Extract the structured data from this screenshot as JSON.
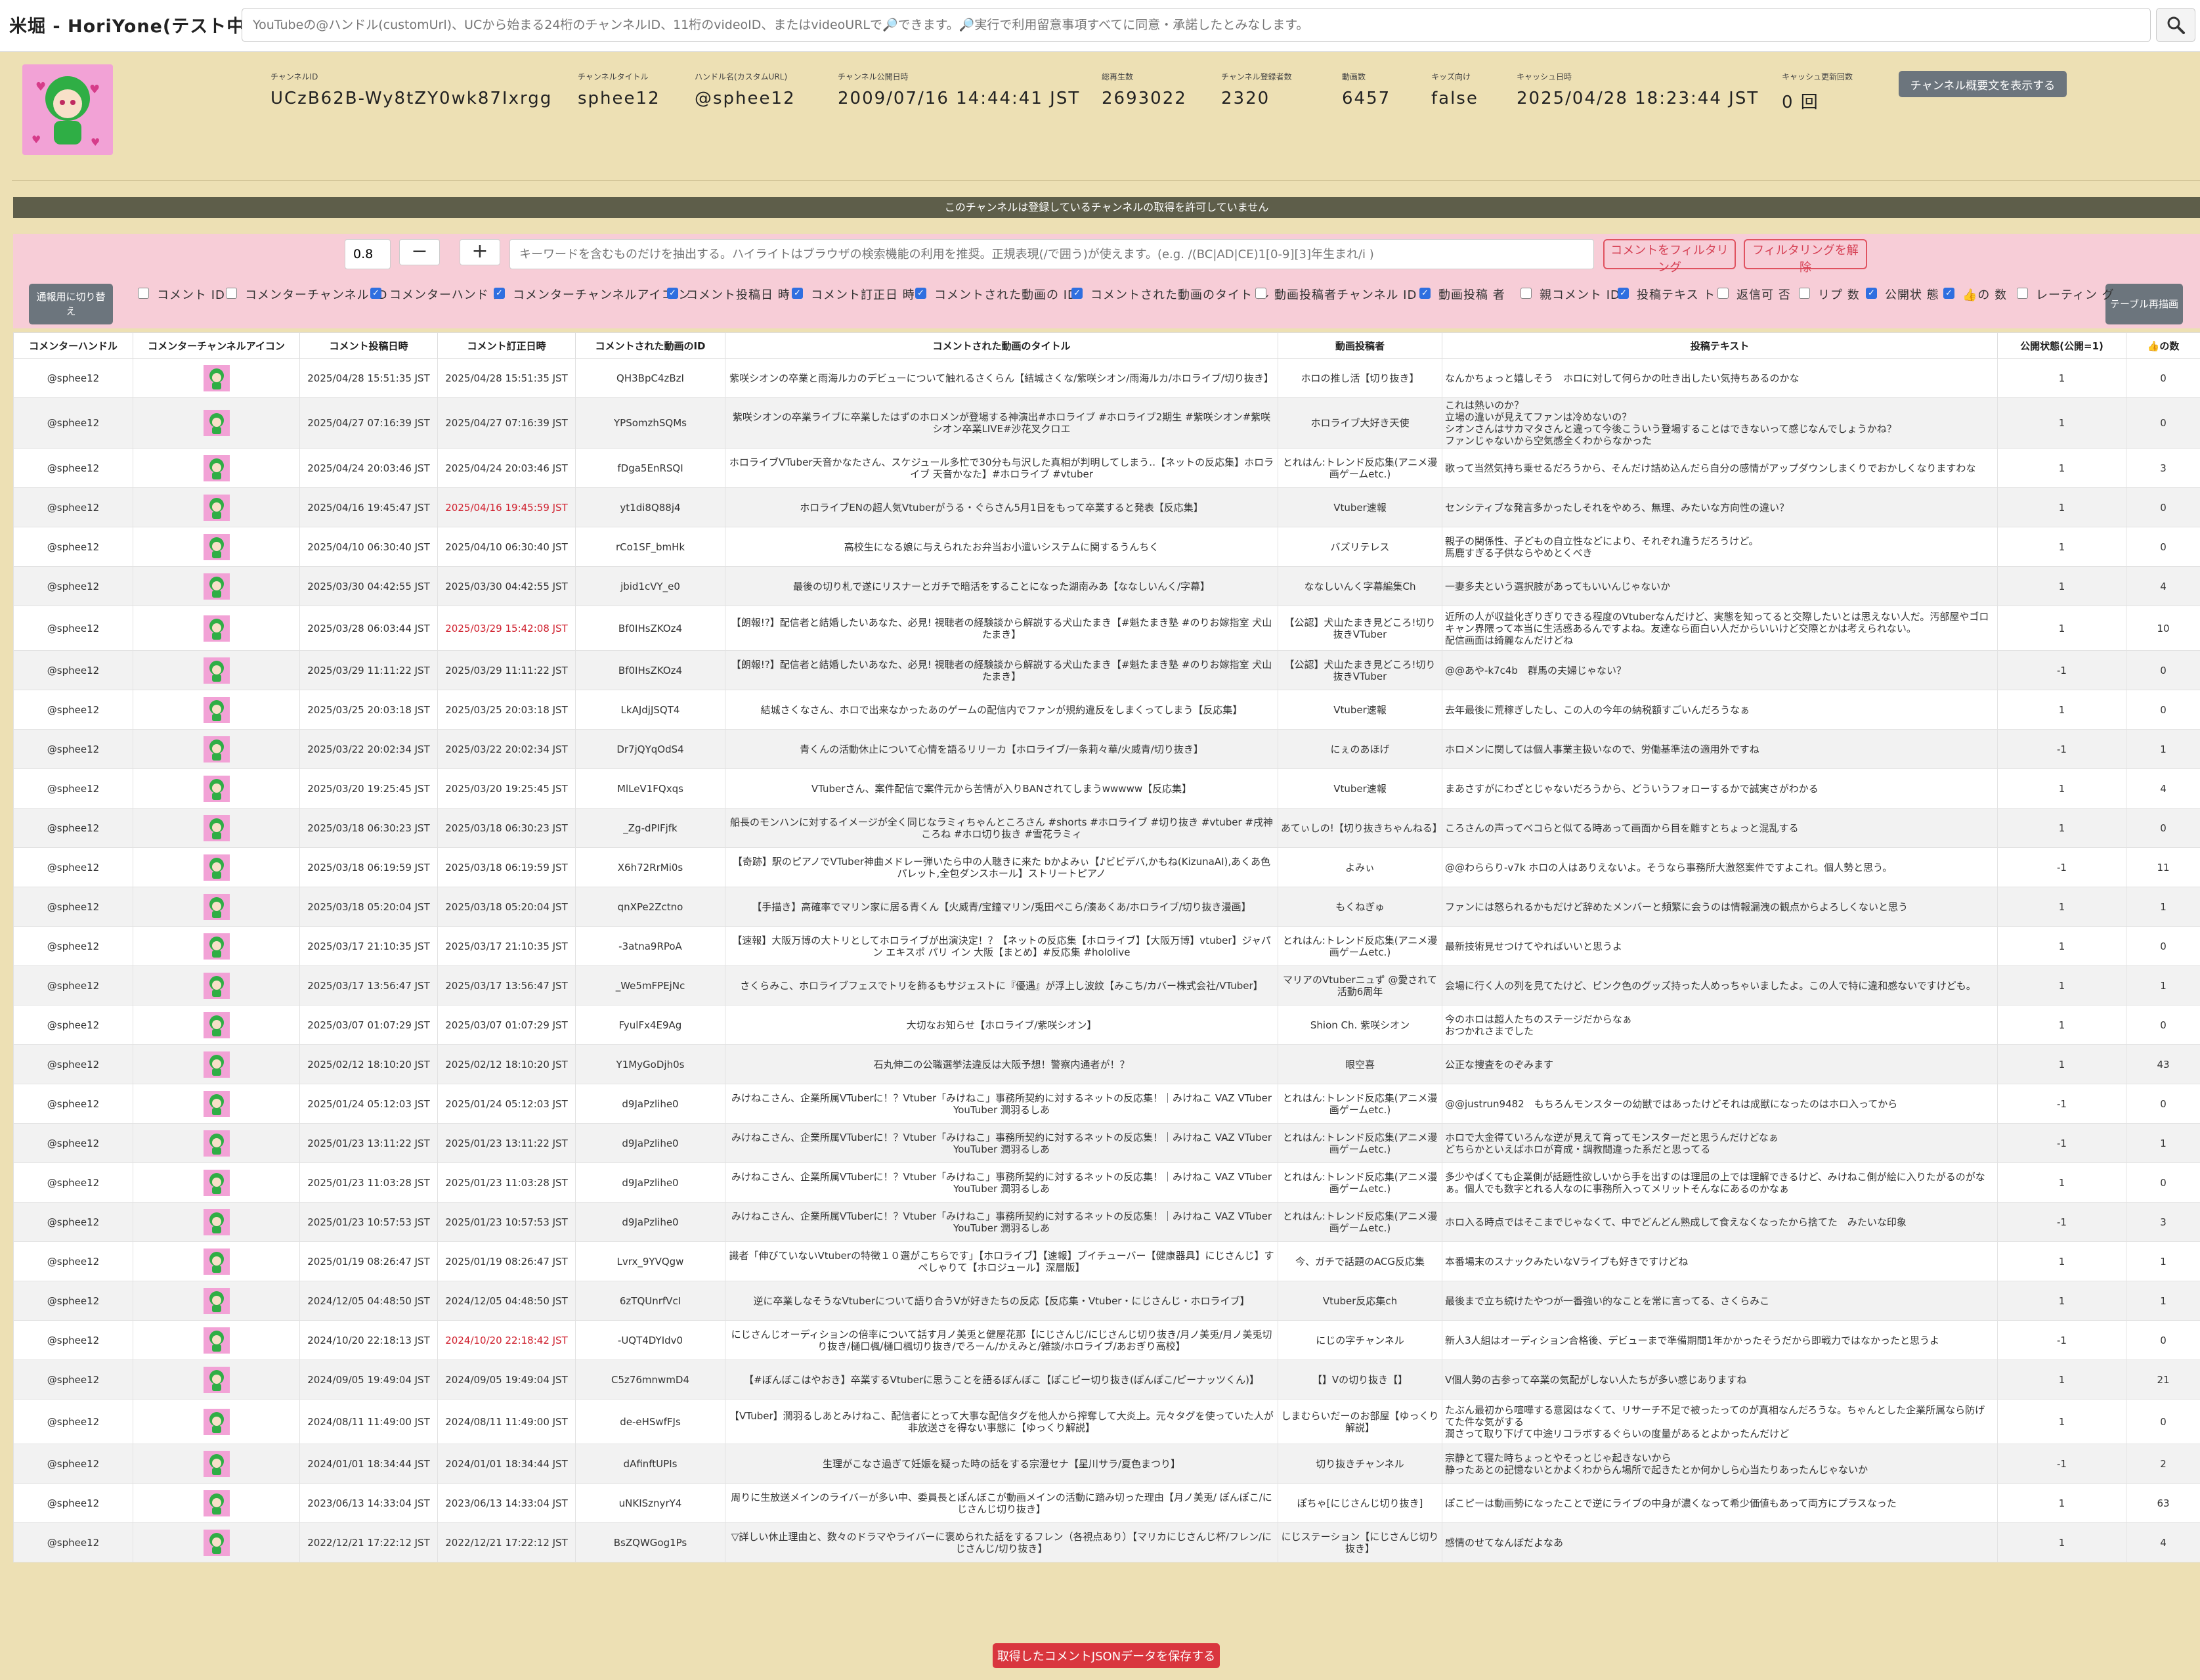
{
  "app": {
    "title": "米堀 - HoriYone(テスト中)"
  },
  "search": {
    "placeholder": "YouTubeの@ハンドル(customUrl)、UCから始まる24桁のチャンネルID、11桁のvideoID、またはvideoURLで🔎できます。🔎実行で利用留意事項すべてに同意・承諾したとみなします。"
  },
  "channel": {
    "fields": [
      {
        "label": "チャンネルID",
        "value": "UCzB62B-Wy8tZY0wk87Ixrgg"
      },
      {
        "label": "チャンネルタイトル",
        "value": "sphee12"
      },
      {
        "label": "ハンドル名(カスタムURL)",
        "value": "@sphee12"
      },
      {
        "label": "チャンネル公開日時",
        "value": "2009/07/16 14:44:41 JST"
      },
      {
        "label": "総再生数",
        "value": "2693022"
      },
      {
        "label": "チャンネル登録者数",
        "value": "2320"
      },
      {
        "label": "動画数",
        "value": "6457"
      },
      {
        "label": "キッズ向け",
        "value": "false"
      },
      {
        "label": "キャッシュ日時",
        "value": "2025/04/28 18:23:44 JST"
      },
      {
        "label": "キャッシュ更新回数",
        "value": "0 回"
      }
    ],
    "desc_button": "チャンネル概要文を表示する"
  },
  "notice": "このチャンネルは登録しているチャンネルの取得を許可していません",
  "filter": {
    "threshold": "0.8",
    "minus": "−",
    "plus": "+",
    "keyword_placeholder": "キーワードを含むものだけを抽出する。ハイライトはブラウザの検索機能の利用を推奨。正規表現(/で囲う)が使えます。(e.g. /(BC|AD|CE)1[0-9][3]年生まれ/i )",
    "apply_button": "コメントをフィルタリング",
    "clear_button": "フィルタリングを解除",
    "switch_button": "通報用に切り替え",
    "redraw_button": "テーブル再描画",
    "columns": [
      {
        "label": "コメント ID",
        "checked": false
      },
      {
        "label": "コメンターチャンネル ID",
        "checked": false
      },
      {
        "label": "コメンターハンド ル",
        "checked": true
      },
      {
        "label": "コメンターチャンネルアイコ ン",
        "checked": true
      },
      {
        "label": "コメント投稿日 時",
        "checked": true
      },
      {
        "label": "コメント訂正日 時",
        "checked": true
      },
      {
        "label": "コメントされた動画の ID",
        "checked": true
      },
      {
        "label": "コメントされた動画のタイト ル",
        "checked": true
      },
      {
        "label": "動画投稿者チャンネル ID",
        "checked": false
      },
      {
        "label": "動画投稿 者",
        "checked": true
      },
      {
        "label": "親コメント ID",
        "checked": false
      },
      {
        "label": "投稿テキス ト",
        "checked": true
      },
      {
        "label": "返信可 否",
        "checked": false
      },
      {
        "label": "リプ 数",
        "checked": false
      },
      {
        "label": "公開状 態",
        "checked": true
      },
      {
        "label": "👍の 数",
        "checked": true
      },
      {
        "label": "レーティン グ",
        "checked": false
      }
    ]
  },
  "table": {
    "headers": [
      "コメンターハンドル",
      "コメンターチャンネルアイコン",
      "コメント投稿日時",
      "コメント訂正日時",
      "コメントされた動画のID",
      "コメントされた動画のタイトル",
      "動画投稿者",
      "投稿テキスト",
      "公開状態(公開=1)",
      "👍の数"
    ],
    "rows": [
      {
        "handle": "@sphee12",
        "posted": "2025/04/28 15:51:35 JST",
        "edited": "2025/04/28 15:51:35 JST",
        "edited_red": false,
        "video_id": "QH3BpC4zBzI",
        "title": "紫咲シオンの卒業と雨海ルカのデビューについて触れるさくらん【結城さくな/紫咲シオン/雨海ルカ/ホロライブ/切り抜き】",
        "uploader": "ホロの推し活【切り抜き】",
        "text": "なんかちょっと嬉しそう　ホロに対して何らかの吐き出したい気持ちあるのかな",
        "status": "1",
        "likes": "0"
      },
      {
        "handle": "@sphee12",
        "posted": "2025/04/27 07:16:39 JST",
        "edited": "2025/04/27 07:16:39 JST",
        "edited_red": false,
        "video_id": "YPSomzhSQMs",
        "title": "紫咲シオンの卒業ライブに卒業したはずのホロメンが登場する神演出#ホロライブ #ホロライブ2期生 #紫咲シオン#紫咲シオン卒業LIVE#沙花叉クロエ",
        "uploader": "ホロライブ大好き天使",
        "text": "これは熱いのか？\n立場の違いが見えてファンは冷めないの？\nシオンさんはサカマタさんと違って今後こういう登場することはできないって感じなんでしょうかね？\nファンじゃないから空気感全くわからなかった",
        "status": "1",
        "likes": "0"
      },
      {
        "handle": "@sphee12",
        "posted": "2025/04/24 20:03:46 JST",
        "edited": "2025/04/24 20:03:46 JST",
        "edited_red": false,
        "video_id": "fDga5EnRSQI",
        "title": "ホロライブVTuber天音かなたさん、スケジュール多忙で30分も与沢した真相が判明してしまう‥【ネットの反応集】ホロライブ 天音かなた】#ホロライブ #vtuber",
        "uploader": "とれはん:トレンド反応集(アニメ漫画ゲームetc.)",
        "text": "歌って当然気持ち乗せるだろうから、そんだけ詰め込んだら自分の感情がアップダウンしまくりでおかしくなりますわな",
        "status": "1",
        "likes": "3"
      },
      {
        "handle": "@sphee12",
        "posted": "2025/04/16 19:45:47 JST",
        "edited": "2025/04/16 19:45:59 JST",
        "edited_red": true,
        "video_id": "yt1di8Q88j4",
        "title": "ホロライブENの超人気Vtuberがうる・ぐらさん5月1日をもって卒業すると発表【反応集】",
        "uploader": "Vtuber速報",
        "text": "センシティブな発言多かったしそれをやめろ、無理、みたいな方向性の違い？",
        "status": "1",
        "likes": "0"
      },
      {
        "handle": "@sphee12",
        "posted": "2025/04/10 06:30:40 JST",
        "edited": "2025/04/10 06:30:40 JST",
        "edited_red": false,
        "video_id": "rCo1SF_bmHk",
        "title": "高校生になる娘に与えられたお弁当お小遣いシステムに関するうんちく",
        "uploader": "バズリテレス",
        "text": "親子の関係性、子どもの自立性などにより、それぞれ違うだろうけど。\n馬鹿すぎる子供ならやめとくべき",
        "status": "1",
        "likes": "0"
      },
      {
        "handle": "@sphee12",
        "posted": "2025/03/30 04:42:55 JST",
        "edited": "2025/03/30 04:42:55 JST",
        "edited_red": false,
        "video_id": "jbid1cVY_e0",
        "title": "最後の切り札で遂にリスナーとガチで暗活をすることになった湖南みあ【ななしいんく/字幕】",
        "uploader": "ななしいんく字幕編集Ch",
        "text": "一妻多夫という選択肢があってもいいんじゃないか",
        "status": "1",
        "likes": "4"
      },
      {
        "handle": "@sphee12",
        "posted": "2025/03/28 06:03:44 JST",
        "edited": "2025/03/29 15:42:08 JST",
        "edited_red": true,
        "video_id": "Bf0IHsZKOz4",
        "title": "【朗報!?】配信者と結婚したいあなた、必見! 視聴者の経験談から解説する犬山たまき【#魁たまき塾 #のりお嫁指室 犬山たまき】",
        "uploader": "【公認】犬山たまき見どころ!切り抜きVTuber",
        "text": "近所の人が収益化ぎりぎりできる程度のVtuberなんだけど、実態を知ってると交際したいとは思えない人だ。汚部屋やゴロキャン界隈って本当に生活感あるんですよね。友達なら面白い人だからいいけど交際とかは考えられない。\n配信画面は綺麗なんだけどね",
        "status": "1",
        "likes": "10"
      },
      {
        "handle": "@sphee12",
        "posted": "2025/03/29 11:11:22 JST",
        "edited": "2025/03/29 11:11:22 JST",
        "edited_red": false,
        "video_id": "Bf0IHsZKOz4",
        "title": "【朗報!?】配信者と結婚したいあなた、必見! 視聴者の経験談から解説する犬山たまき【#魁たまき塾 #のりお嫁指室 犬山たまき】",
        "uploader": "【公認】犬山たまき見どころ!切り抜きVTuber",
        "text": "@@あや-k7c4b　群馬の夫婦じゃない？",
        "status": "-1",
        "likes": "0"
      },
      {
        "handle": "@sphee12",
        "posted": "2025/03/25 20:03:18 JST",
        "edited": "2025/03/25 20:03:18 JST",
        "edited_red": false,
        "video_id": "LkAJdjJSQT4",
        "title": "結城さくなさん、ホロで出来なかったあのゲームの配信内でファンが規約違反をしまくってしまう【反応集】",
        "uploader": "Vtuber速報",
        "text": "去年最後に荒稼ぎしたし、この人の今年の納税額すごいんだろうなぁ",
        "status": "1",
        "likes": "0"
      },
      {
        "handle": "@sphee12",
        "posted": "2025/03/22 20:02:34 JST",
        "edited": "2025/03/22 20:02:34 JST",
        "edited_red": false,
        "video_id": "Dr7jQYqOdS4",
        "title": "青くんの活動休止について心情を語るリリーカ【ホロライブ/一条莉々華/火威青/切り抜き】",
        "uploader": "にぇのあほげ",
        "text": "ホロメンに関しては個人事業主扱いなので、労働基準法の適用外ですね",
        "status": "-1",
        "likes": "1"
      },
      {
        "handle": "@sphee12",
        "posted": "2025/03/20 19:25:45 JST",
        "edited": "2025/03/20 19:25:45 JST",
        "edited_red": false,
        "video_id": "MlLeV1FQxqs",
        "title": "VTuberさん、案件配信で案件元から苦情が入りBANされてしまうwwwww【反応集】",
        "uploader": "Vtuber速報",
        "text": "まあさすがにわざとじゃないだろうから、どういうフォローするかで誠実さがわかる",
        "status": "1",
        "likes": "4"
      },
      {
        "handle": "@sphee12",
        "posted": "2025/03/18 06:30:23 JST",
        "edited": "2025/03/18 06:30:23 JST",
        "edited_red": false,
        "video_id": "_Zg-dPIFjfk",
        "title": "船長のモンハンに対するイメージが全く同じなラミィちゃんところさん #shorts #ホロライブ #切り抜き #vtuber #戌神ころね #ホロ切り抜き #雪花ラミィ",
        "uploader": "あてぃしの!【切り抜きちゃんねる】",
        "text": "ころさんの声ってベコらと似てる時あって画面から目を離すとちょっと混乱する",
        "status": "1",
        "likes": "0"
      },
      {
        "handle": "@sphee12",
        "posted": "2025/03/18 06:19:59 JST",
        "edited": "2025/03/18 06:19:59 JST",
        "edited_red": false,
        "video_id": "X6h72RrMi0s",
        "title": "【奇跡】駅のピアノでVTuber神曲メドレー弾いたら中の人聴きに来た bかよみぃ【♪ビビデバ,かもね(KizunaAI),あくあ色パレット,全包ダンスホール】ストリートピアノ",
        "uploader": "よみぃ",
        "text": "@@わららり-v7k ホロの人はありえないよ。そうなら事務所大激怒案件ですよこれ。個人勢と思う。",
        "status": "-1",
        "likes": "11"
      },
      {
        "handle": "@sphee12",
        "posted": "2025/03/18 05:20:04 JST",
        "edited": "2025/03/18 05:20:04 JST",
        "edited_red": false,
        "video_id": "qnXPe2Zctno",
        "title": "【手描き】高確率でマリン家に居る青くん【火威青/宝鐘マリン/兎田ぺこら/湊あくあ/ホロライブ/切り抜き漫画】",
        "uploader": "もくねぎゅ",
        "text": "ファンには怒られるかもだけど辞めたメンバーと頻繁に会うのは情報漏洩の観点からよろしくないと思う",
        "status": "1",
        "likes": "1"
      },
      {
        "handle": "@sphee12",
        "posted": "2025/03/17 21:10:35 JST",
        "edited": "2025/03/17 21:10:35 JST",
        "edited_red": false,
        "video_id": "-3atna9RPoA",
        "title": "【速報】大阪万博の大トリとしてホロライブが出演決定！？【ネットの反応集【ホロライブ】【大阪万博】vtuber】ジャパン エキスポ パリ イン 大阪【まとめ】#反応集 #hololive",
        "uploader": "とれはん:トレンド反応集(アニメ漫画ゲームetc.)",
        "text": "最新技術見せつけてやればいいと思うよ",
        "status": "1",
        "likes": "0"
      },
      {
        "handle": "@sphee12",
        "posted": "2025/03/17 13:56:47 JST",
        "edited": "2025/03/17 13:56:47 JST",
        "edited_red": false,
        "video_id": "_We5mFPEjNc",
        "title": "さくらみこ、ホロライブフェスでトリを飾るもサジェストに『優遇』が浮上し波紋【みこち/カバー株式会社/VTuber】",
        "uploader": "マリアのVtuberニュず @愛されて活動6周年",
        "text": "会場に行く人の列を見てたけど、ピンク色のグッズ持った人めっちゃいましたよ。この人で特に違和感ないですけども。",
        "status": "1",
        "likes": "1"
      },
      {
        "handle": "@sphee12",
        "posted": "2025/03/07 01:07:29 JST",
        "edited": "2025/03/07 01:07:29 JST",
        "edited_red": false,
        "video_id": "FyulFx4E9Ag",
        "title": "大切なお知らせ【ホロライブ/紫咲シオン】",
        "uploader": "Shion Ch. 紫咲シオン",
        "text": "今のホロは超人たちのステージだからなぁ\nおつかれさまでした",
        "status": "1",
        "likes": "0"
      },
      {
        "handle": "@sphee12",
        "posted": "2025/02/12 18:10:20 JST",
        "edited": "2025/02/12 18:10:20 JST",
        "edited_red": false,
        "video_id": "Y1MyGoDjh0s",
        "title": "石丸伸二の公職選挙法違反は大阪予想！警察内通者が！？",
        "uploader": "眼空喜",
        "text": "公正な捜査をのぞみます",
        "status": "1",
        "likes": "43"
      },
      {
        "handle": "@sphee12",
        "posted": "2025/01/24 05:12:03 JST",
        "edited": "2025/01/24 05:12:03 JST",
        "edited_red": false,
        "video_id": "d9JaPzlihe0",
        "title": "みけねこさん、企業所属VTuberに！？Vtuber「みけねこ」事務所契約に対するネットの反応集！｜みけねこ VAZ VTuber YouTuber 潤羽るしあ",
        "uploader": "とれはん:トレンド反応集(アニメ漫画ゲームetc.)",
        "text": "@@justrun9482　もちろんモンスターの幼獣ではあったけどそれは成獣になったのはホロ入ってから",
        "status": "-1",
        "likes": "0"
      },
      {
        "handle": "@sphee12",
        "posted": "2025/01/23 13:11:22 JST",
        "edited": "2025/01/23 13:11:22 JST",
        "edited_red": false,
        "video_id": "d9JaPzlihe0",
        "title": "みけねこさん、企業所属VTuberに！？Vtuber「みけねこ」事務所契約に対するネットの反応集！｜みけねこ VAZ VTuber YouTuber 潤羽るしあ",
        "uploader": "とれはん:トレンド反応集(アニメ漫画ゲームetc.)",
        "text": "ホロで大金得ていろんな逆が見えて育ってモンスターだと思うんだけどなぁ\nどちらかといえばホロが育成・調教間違った系だと思ってる",
        "status": "-1",
        "likes": "1"
      },
      {
        "handle": "@sphee12",
        "posted": "2025/01/23 11:03:28 JST",
        "edited": "2025/01/23 11:03:28 JST",
        "edited_red": false,
        "video_id": "d9JaPzlihe0",
        "title": "みけねこさん、企業所属VTuberに！？Vtuber「みけねこ」事務所契約に対するネットの反応集！｜みけねこ VAZ VTuber YouTuber 潤羽るしあ",
        "uploader": "とれはん:トレンド反応集(アニメ漫画ゲームetc.)",
        "text": "多少やばくても企業側が話題性欲しいから手を出すのは理屈の上では理解できるけど、みけねこ側が絵に入りたがるのがなぁ。個人でも数字とれる人なのに事務所入ってメリットそんなにあるのかなぁ",
        "status": "1",
        "likes": "0"
      },
      {
        "handle": "@sphee12",
        "posted": "2025/01/23 10:57:53 JST",
        "edited": "2025/01/23 10:57:53 JST",
        "edited_red": false,
        "video_id": "d9JaPzlihe0",
        "title": "みけねこさん、企業所属VTuberに！？Vtuber「みけねこ」事務所契約に対するネットの反応集！｜みけねこ VAZ VTuber YouTuber 潤羽るしあ",
        "uploader": "とれはん:トレンド反応集(アニメ漫画ゲームetc.)",
        "text": "ホロ入る時点ではそこまでじゃなくて、中でどんどん熟成して食えなくなったから捨てた　みたいな印象",
        "status": "-1",
        "likes": "3"
      },
      {
        "handle": "@sphee12",
        "posted": "2025/01/19 08:26:47 JST",
        "edited": "2025/01/19 08:26:47 JST",
        "edited_red": false,
        "video_id": "Lvrx_9YVQgw",
        "title": "識者「伸びていないVtuberの特徴１０選がこちらです」【ホロライブ】【速報】ブイチューバー【健康器具】にじさんじ】すぺしゃりて【ホロジュール】深層版】",
        "uploader": "今、ガチで話題のACG反応集",
        "text": "本番場末のスナックみたいなVライブも好きですけどね",
        "status": "1",
        "likes": "1"
      },
      {
        "handle": "@sphee12",
        "posted": "2024/12/05 04:48:50 JST",
        "edited": "2024/12/05 04:48:50 JST",
        "edited_red": false,
        "video_id": "6zTQUnrfVcI",
        "title": "逆に卒業しなそうなVtuberについて語り合うVが好きたちの反応【反応集・Vtuber・にじさんじ・ホロライブ】",
        "uploader": "Vtuber反応集ch",
        "text": "最後まで立ち続けたやつが一番強い的なことを常に言ってる、さくらみこ",
        "status": "1",
        "likes": "1"
      },
      {
        "handle": "@sphee12",
        "posted": "2024/10/20 22:18:13 JST",
        "edited": "2024/10/20 22:18:42 JST",
        "edited_red": true,
        "video_id": "-UQT4DYIdv0",
        "title": "にじさんじオーディションの倍率について話す月ノ美兎と健屋花那【にじさんじ/にじさんじ切り抜き/月ノ美兎/月ノ美兎切り抜き/樋口楓/樋口楓切り抜き/でろーん/かえみと/雑談/ホロライブ/あおぎり高校】",
        "uploader": "にじの字チャンネル",
        "text": "新人3人組はオーディション合格後、デビューまで準備期間1年かかったそうだから即戦力ではなかったと思うよ",
        "status": "-1",
        "likes": "0"
      },
      {
        "handle": "@sphee12",
        "posted": "2024/09/05 19:49:04 JST",
        "edited": "2024/09/05 19:49:04 JST",
        "edited_red": false,
        "video_id": "C5z76mnwmD4",
        "title": "【#ぼんぼこはやおき】卒業するVtuberに思うことを語るぼんぼこ【ぽこピー切り抜き(ぽんぽこ/ピーナッツくん)】",
        "uploader": "【】Vの切り抜き【】",
        "text": "V個人勢の古参って卒業の気配がしない人たちが多い感じありますね",
        "status": "1",
        "likes": "21"
      },
      {
        "handle": "@sphee12",
        "posted": "2024/08/11 11:49:00 JST",
        "edited": "2024/08/11 11:49:00 JST",
        "edited_red": false,
        "video_id": "de-eHSwfFJs",
        "title": "【VTuber】潤羽るしあとみけねこ、配信者にとって大事な配信タグを他人から搾奪して大炎上。元々タグを使っていた人が非放送さを得ない事態に【ゆっくり解説】",
        "uploader": "しまむらいだーのお部屋【ゆっくり解説】",
        "text": "たぶん最初から喧嘩する意図はなくて、リサーチ不足で被ったってのが真相なんだろうな。ちゃんとした企業所属なら防げてた件な気がする\n潤さって取り下げて中途リコラボするぐらいの度量があるとよかったんだけど",
        "status": "1",
        "likes": "0"
      },
      {
        "handle": "@sphee12",
        "posted": "2024/01/01 18:34:44 JST",
        "edited": "2024/01/01 18:34:44 JST",
        "edited_red": false,
        "video_id": "dAfinftUPIs",
        "title": "生理がこなさ過ぎて妊娠を疑った時の話をする宗澄セナ【星川サラ/夏色まつり】",
        "uploader": "切り抜きチャンネル",
        "text": "宗静とて寝た時ちょっとやそっとじゃ起きないから\n静ったあとの記憶ないとかよくわからん場所で起きたとか何かしら心当たりあったんじゃないか",
        "status": "-1",
        "likes": "2"
      },
      {
        "handle": "@sphee12",
        "posted": "2023/06/13 14:33:04 JST",
        "edited": "2023/06/13 14:33:04 JST",
        "edited_red": false,
        "video_id": "uNKISznyrY4",
        "title": "周りに生放送メインのライバーが多い中、委員長とぽんぼこが動画メインの活動に踏み切った理由【月ノ美兎/ ぽんぽこ/にじさんじ切り抜き】",
        "uploader": "ぽちゃ[にじさんじ切り抜き]",
        "text": "ぽこピーは動画勢になったことで逆にライブの中身が濃くなって希少価値もあって両方にプラスなった",
        "status": "1",
        "likes": "63"
      },
      {
        "handle": "@sphee12",
        "posted": "2022/12/21 17:22:12 JST",
        "edited": "2022/12/21 17:22:12 JST",
        "edited_red": false,
        "video_id": "BsZQWGog1Ps",
        "title": "▽詳しい休止理由と、数々のドラマやライバーに褒められた話をするフレン（各視点あり）【マリカにじさんじ杯/フレン/にじさんじ/切り抜き】",
        "uploader": "にじステーション【にじさんじ切り抜き】",
        "text": "感情のせてなんぼだよなあ",
        "status": "1",
        "likes": "4"
      }
    ]
  },
  "footer": {
    "save_button": "取得したコメントJSONデータを保存する"
  }
}
